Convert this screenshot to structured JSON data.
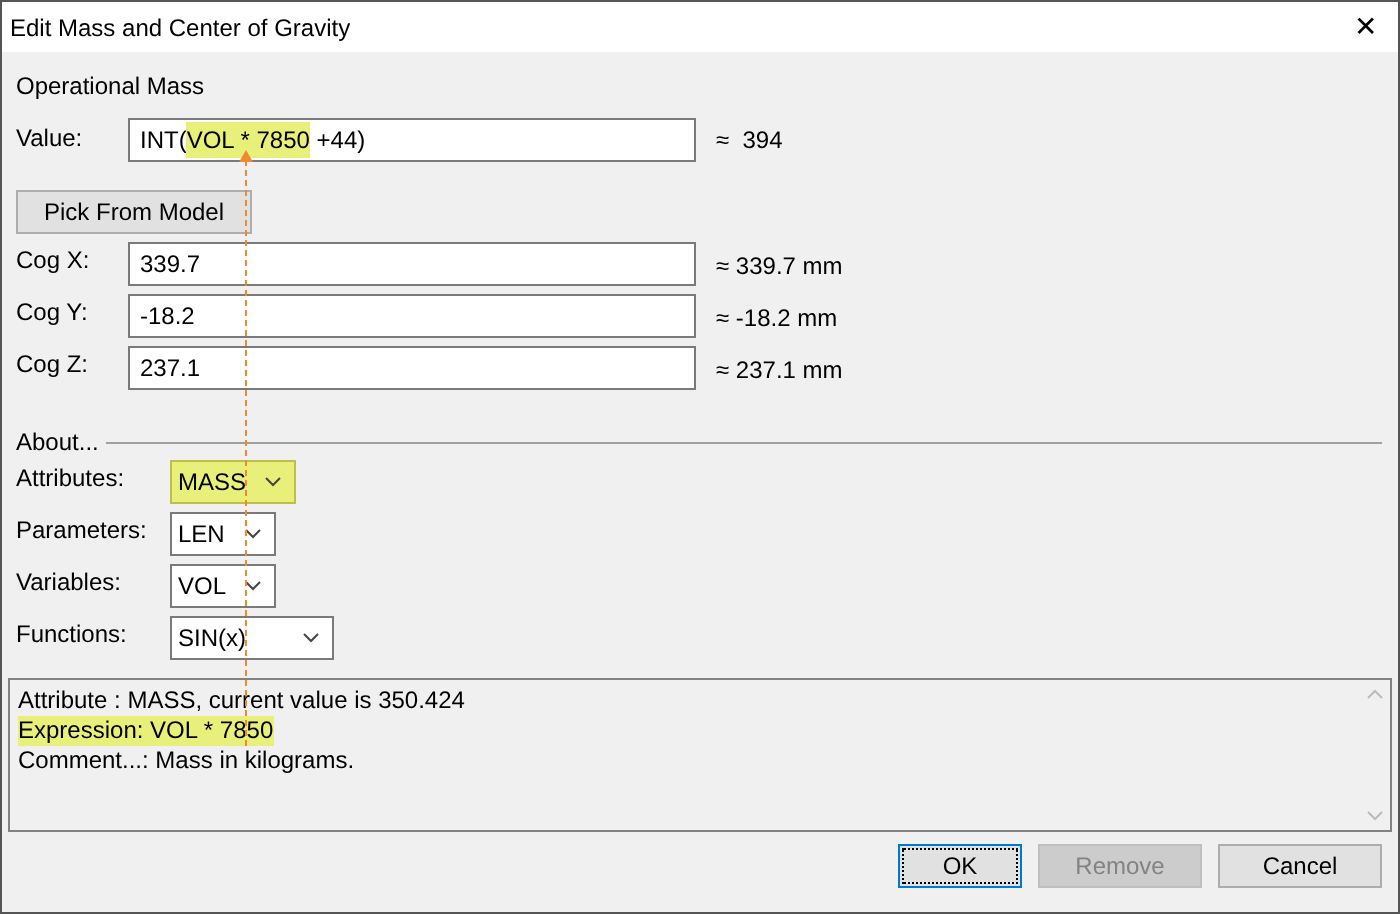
{
  "window": {
    "title": "Edit Mass and Center of Gravity",
    "close": "✕"
  },
  "section": "Operational Mass",
  "value": {
    "label": "Value:",
    "parts": [
      {
        "text": "INT(",
        "highlighted": false
      },
      {
        "text": "VOL * 7850",
        "highlighted": true
      },
      {
        "text": " +44)",
        "highlighted": false
      }
    ],
    "result": "≈  394"
  },
  "pick_button": "Pick From Model",
  "cog": [
    {
      "label": "Cog X:",
      "value": "339.7",
      "result": "≈ 339.7 mm"
    },
    {
      "label": "Cog Y:",
      "value": "-18.2",
      "result": "≈ -18.2 mm"
    },
    {
      "label": "Cog Z:",
      "value": "237.1",
      "result": "≈ 237.1 mm"
    }
  ],
  "about": "About...",
  "dropdowns": [
    {
      "label": "Attributes:",
      "value": "MASS",
      "highlighted": true
    },
    {
      "label": "Parameters:",
      "value": "LEN",
      "highlighted": false
    },
    {
      "label": "Variables:",
      "value": "VOL",
      "highlighted": false
    },
    {
      "label": "Functions:",
      "value": "SIN(x)",
      "highlighted": false
    }
  ],
  "info_lines": [
    {
      "text": "Attribute : MASS,  current value is 350.424",
      "highlighted": false
    },
    {
      "text": "Expression: VOL * 7850",
      "highlighted": true
    },
    {
      "text": "Comment...: Mass in kilograms.",
      "highlighted": false
    }
  ],
  "buttons": [
    {
      "label": "OK",
      "disabled": false,
      "default": true
    },
    {
      "label": "Remove",
      "disabled": true,
      "default": false
    },
    {
      "label": "Cancel",
      "disabled": false,
      "default": false
    }
  ]
}
